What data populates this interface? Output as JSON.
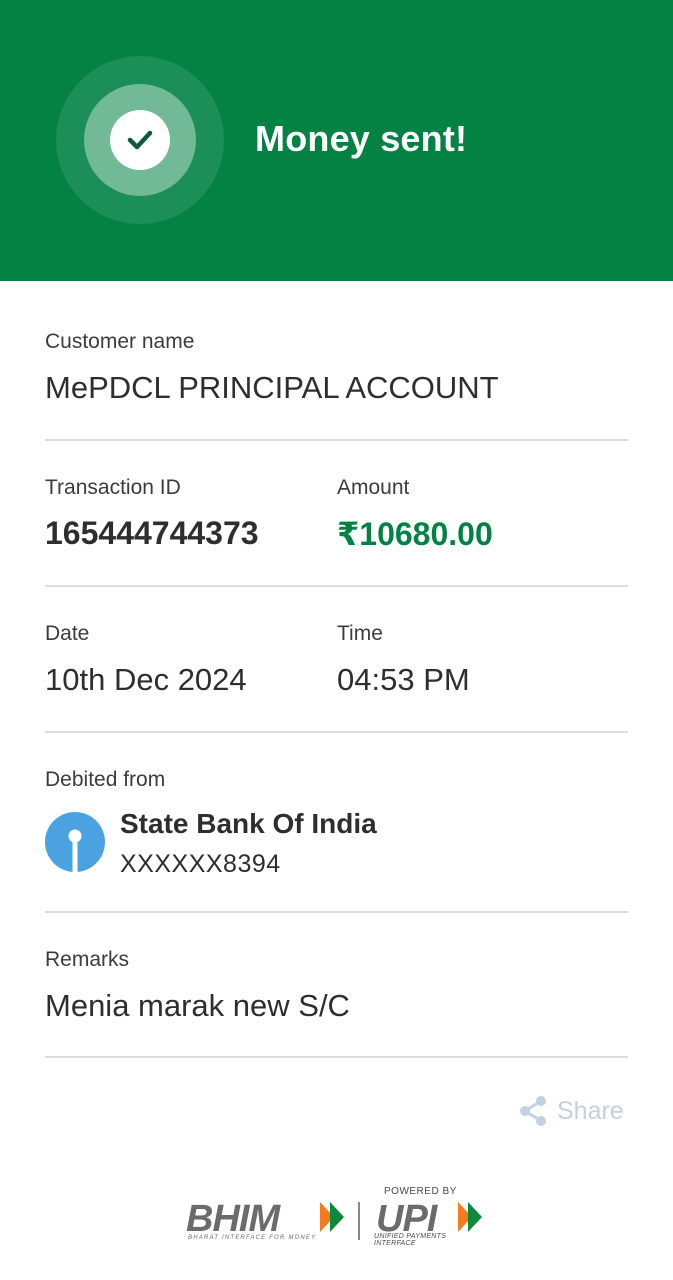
{
  "header": {
    "title": "Money sent!",
    "background_color": "#038244",
    "status_icon": "check-icon"
  },
  "customer": {
    "label": "Customer name",
    "value": "MePDCL PRINCIPAL ACCOUNT"
  },
  "transaction": {
    "id_label": "Transaction ID",
    "id_value": "165444744373",
    "amount_label": "Amount",
    "amount_value": "₹10680.00",
    "amount_color": "#038244"
  },
  "datetime": {
    "date_label": "Date",
    "date_value": "10th Dec 2024",
    "time_label": "Time",
    "time_value": "04:53 PM"
  },
  "debit": {
    "label": "Debited from",
    "bank_name": "State Bank Of India",
    "account": "XXXXXX8394",
    "bank_icon": "sbi-logo-icon",
    "bank_color": "#4aa3e0"
  },
  "remarks": {
    "label": "Remarks",
    "value": "Menia marak new S/C"
  },
  "share": {
    "label": "Share",
    "icon": "share-icon"
  },
  "footer": {
    "bhim_logo": "BHIM",
    "bhim_tagline": "BHARAT INTERFACE FOR MONEY",
    "powered_by": "POWERED BY",
    "upi_logo": "UPI",
    "upi_tagline": "UNIFIED PAYMENTS INTERFACE"
  }
}
